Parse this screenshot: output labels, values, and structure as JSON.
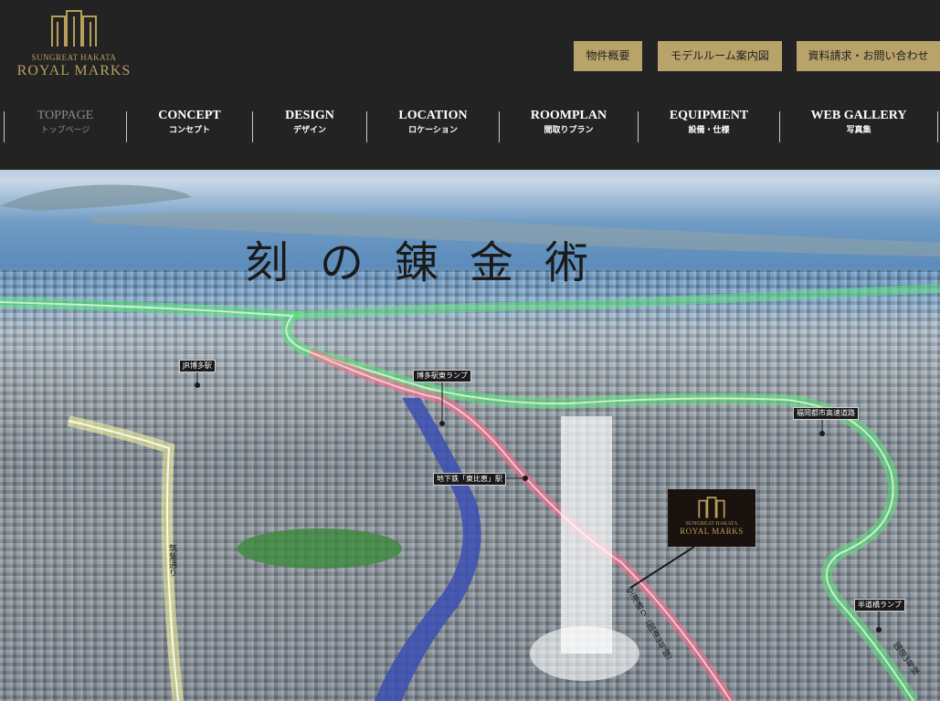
{
  "brand": {
    "sub": "SUNGREAT HAKATA",
    "main": "ROYAL MARKS",
    "gold": "#b59f5b"
  },
  "top_buttons": [
    {
      "label": "物件概要"
    },
    {
      "label": "モデルルーム案内図"
    },
    {
      "label": "資料請求・お問い合わせ"
    }
  ],
  "nav": [
    {
      "en": "TOPPAGE",
      "jp": "トップページ",
      "active": true
    },
    {
      "en": "CONCEPT",
      "jp": "コンセプト"
    },
    {
      "en": "DESIGN",
      "jp": "デザイン"
    },
    {
      "en": "LOCATION",
      "jp": "ロケーション"
    },
    {
      "en": "ROOMPLAN",
      "jp": "間取りプラン"
    },
    {
      "en": "EQUIPMENT",
      "jp": "設備・仕様"
    },
    {
      "en": "WEB GALLERY",
      "jp": "写真集"
    }
  ],
  "hero": {
    "tagline": "刻の錬金術",
    "labels": {
      "jr": "JR博多駅",
      "east_ramp": "博多駅東ランプ",
      "subway": "地下鉄「東比恵」駅",
      "expressway": "福岡都市高速道路",
      "handou_ramp": "半道橋ランプ",
      "chikushi": "筑紫通り",
      "airport_road": "空港通り（国道3号線）",
      "kunado": "国道3号線"
    }
  },
  "colors": {
    "header_bg": "#232323",
    "button_bg": "#b8a36a",
    "green_route": "#59e37a",
    "red_route": "#ff6a8a",
    "yellow_route": "#f4f2a0"
  }
}
